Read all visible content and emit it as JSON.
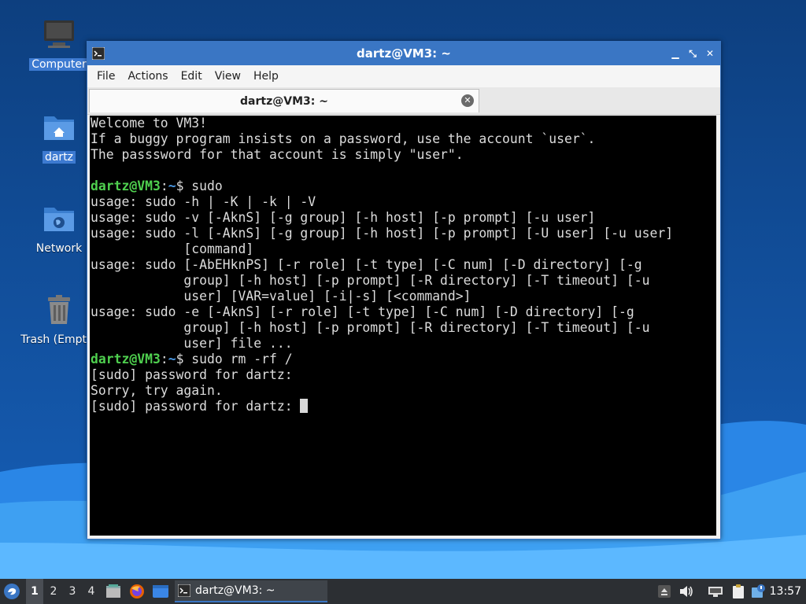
{
  "desktop": {
    "icons": [
      {
        "label": "Computer"
      },
      {
        "label": "dartz"
      },
      {
        "label": "Network"
      },
      {
        "label": "Trash (Empty)"
      }
    ]
  },
  "window": {
    "title": "dartz@VM3: ~",
    "controls": {
      "minimize": "▁",
      "maximize": "⤡",
      "close": "✕"
    },
    "menu": [
      "File",
      "Actions",
      "Edit",
      "View",
      "Help"
    ],
    "tab": {
      "label": "dartz@VM3: ~",
      "close": "✕"
    }
  },
  "terminal": {
    "lines": [
      {
        "text": "Welcome to VM3!"
      },
      {
        "text": "If a buggy program insists on a password, use the account `user`."
      },
      {
        "text": "The passsword for that account is simply \"user\"."
      },
      {
        "text": ""
      },
      {
        "prompt_user": "dartz@VM3",
        "prompt_sep": ":",
        "prompt_path": "~",
        "text": "$ sudo"
      },
      {
        "text": "usage: sudo -h | -K | -k | -V"
      },
      {
        "text": "usage: sudo -v [-AknS] [-g group] [-h host] [-p prompt] [-u user]"
      },
      {
        "text": "usage: sudo -l [-AknS] [-g group] [-h host] [-p prompt] [-U user] [-u user]"
      },
      {
        "text": "            [command]"
      },
      {
        "text": "usage: sudo [-AbEHknPS] [-r role] [-t type] [-C num] [-D directory] [-g"
      },
      {
        "text": "            group] [-h host] [-p prompt] [-R directory] [-T timeout] [-u"
      },
      {
        "text": "            user] [VAR=value] [-i|-s] [<command>]"
      },
      {
        "text": "usage: sudo -e [-AknS] [-r role] [-t type] [-C num] [-D directory] [-g"
      },
      {
        "text": "            group] [-h host] [-p prompt] [-R directory] [-T timeout] [-u"
      },
      {
        "text": "            user] file ..."
      },
      {
        "prompt_user": "dartz@VM3",
        "prompt_sep": ":",
        "prompt_path": "~",
        "text": "$ sudo rm -rf /"
      },
      {
        "text": "[sudo] password for dartz:"
      },
      {
        "text": "Sorry, try again."
      },
      {
        "text": "[sudo] password for dartz: ",
        "cursor": true
      }
    ]
  },
  "taskbar": {
    "workspaces": [
      "1",
      "2",
      "3",
      "4"
    ],
    "active_workspace": "1",
    "task_label": "dartz@VM3: ~",
    "clock": "13:57"
  },
  "colors": {
    "accent": "#3a76c4",
    "prompt_user": "#4fd04f",
    "prompt_path": "#4c9be8",
    "terminal_bg": "#000000"
  }
}
